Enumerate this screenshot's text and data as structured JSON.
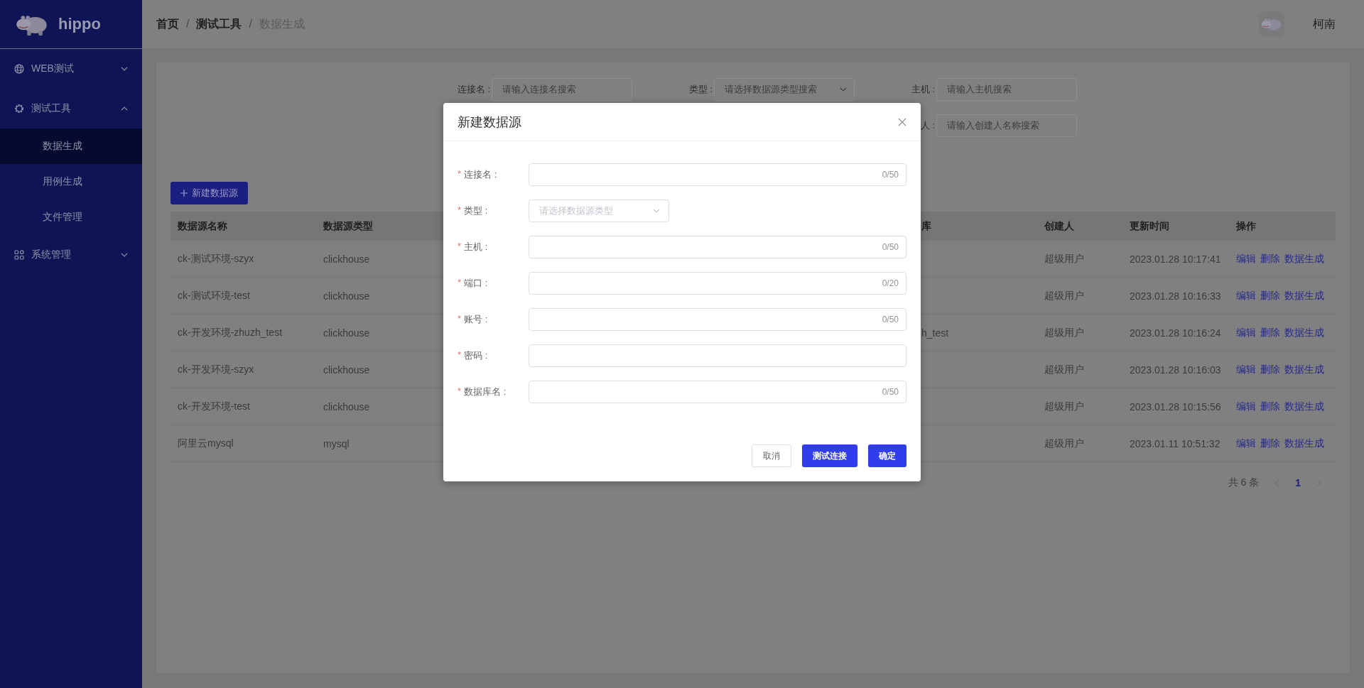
{
  "sidebar": {
    "logo": "hippo",
    "menu": [
      {
        "label": "WEB测试",
        "expanded": false
      },
      {
        "label": "测试工具",
        "expanded": true,
        "children": [
          {
            "label": "数据生成",
            "selected": true
          },
          {
            "label": "用例生成",
            "selected": false
          },
          {
            "label": "文件管理",
            "selected": false
          }
        ]
      },
      {
        "label": "系统管理",
        "expanded": false
      }
    ]
  },
  "header": {
    "separator": "/",
    "breadcrumb": [
      {
        "label": "首页",
        "current": false
      },
      {
        "label": "测试工具",
        "current": false
      },
      {
        "label": "数据生成",
        "current": true
      }
    ],
    "user": "柯南"
  },
  "filters": [
    {
      "label": "连接名 :",
      "kind": "input",
      "placeholder": "请输入连接名搜索"
    },
    {
      "label": "类型 :",
      "kind": "select",
      "placeholder": "请选择数据源类型搜索"
    },
    {
      "label": "主机 :",
      "kind": "input",
      "placeholder": "请输入主机搜索"
    },
    {
      "label": "人 :",
      "kind": "input",
      "placeholder": "请输入创建人名称搜索"
    }
  ],
  "new_button": "新建数据源",
  "table": {
    "columns": [
      "数据源名称",
      "数据源类型",
      "库",
      "创建人",
      "更新时间",
      "操作"
    ],
    "rows": [
      {
        "name": "ck-测试环境-szyx",
        "type": "clickhouse",
        "creator": "超级用户",
        "updated": "2023.01.28 10:17:41",
        "actions": [
          "编辑",
          "删除",
          "数据生成"
        ]
      },
      {
        "name": "ck-测试环境-test",
        "type": "clickhouse",
        "creator": "超级用户",
        "updated": "2023.01.28 10:16:33",
        "actions": [
          "编辑",
          "删除",
          "数据生成"
        ]
      },
      {
        "name": "ck-开发环境-zhuzh_test",
        "type": "clickhouse",
        "column_3": "h_test",
        "creator": "超级用户",
        "updated": "2023.01.28 10:16:24",
        "actions": [
          "编辑",
          "删除",
          "数据生成"
        ]
      },
      {
        "name": "ck-开发环境-szyx",
        "type": "clickhouse",
        "creator": "超级用户",
        "updated": "2023.01.28 10:16:03",
        "actions": [
          "编辑",
          "删除",
          "数据生成"
        ]
      },
      {
        "name": "ck-开发环境-test",
        "type": "clickhouse",
        "creator": "超级用户",
        "updated": "2023.01.28 10:15:56",
        "actions": [
          "编辑",
          "删除",
          "数据生成"
        ]
      },
      {
        "name": "阿里云mysql",
        "type": "mysql",
        "creator": "超级用户",
        "updated": "2023.01.11 10:51:32",
        "actions": [
          "编辑",
          "删除",
          "数据生成"
        ]
      }
    ]
  },
  "pagination": {
    "total": "共 6 条",
    "pages": [
      {
        "label": "1",
        "selected": true
      }
    ]
  },
  "dialog": {
    "title": "新建数据源",
    "required_mark": "*",
    "fields": [
      {
        "label": "连接名 :",
        "kind": "input",
        "required": true,
        "counter": "0/50"
      },
      {
        "label": "类型 :",
        "kind": "select",
        "required": true,
        "placeholder": "请选择数据源类型"
      },
      {
        "label": "主机 :",
        "kind": "input",
        "required": true,
        "counter": "0/50"
      },
      {
        "label": "端口 :",
        "kind": "input",
        "required": true,
        "counter": "0/20"
      },
      {
        "label": "账号 :",
        "kind": "input",
        "required": true,
        "counter": "0/50"
      },
      {
        "label": "密码 :",
        "kind": "input",
        "required": true
      },
      {
        "label": "数据库名 :",
        "kind": "input",
        "required": true,
        "counter": "0/50"
      }
    ],
    "buttons": [
      {
        "label": "取消",
        "primary": false
      },
      {
        "label": "测试连接",
        "primary": true
      },
      {
        "label": "确定",
        "primary": true
      }
    ]
  }
}
